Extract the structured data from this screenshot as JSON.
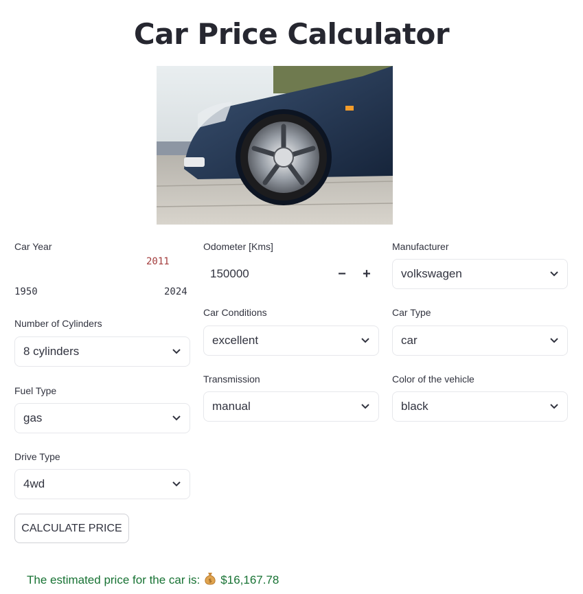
{
  "header": {
    "title": "Car Price Calculator"
  },
  "form": {
    "car_year": {
      "label": "Car Year",
      "value": "2011",
      "min": "1950",
      "max": "2024"
    },
    "odometer": {
      "label": "Odometer [Kms]",
      "value": "150000",
      "minus": "−",
      "plus": "+"
    },
    "manufacturer": {
      "label": "Manufacturer",
      "value": "volkswagen"
    },
    "cylinders": {
      "label": "Number of Cylinders",
      "value": "8 cylinders"
    },
    "condition": {
      "label": "Car Conditions",
      "value": "excellent"
    },
    "car_type": {
      "label": "Car Type",
      "value": "car"
    },
    "fuel": {
      "label": "Fuel Type",
      "value": "gas"
    },
    "transmission": {
      "label": "Transmission",
      "value": "manual"
    },
    "color": {
      "label": "Color of the vehicle",
      "value": "black"
    },
    "drive": {
      "label": "Drive Type",
      "value": "4wd"
    }
  },
  "actions": {
    "calculate_label": "CALCULATE PRICE"
  },
  "result": {
    "text": "The estimated price for the car is:",
    "icon": "money-bag-icon",
    "price": "$16,167.78"
  },
  "colors": {
    "slider_value": "#a33c3c",
    "result_text": "#177233",
    "border": "#e6e7eb"
  }
}
